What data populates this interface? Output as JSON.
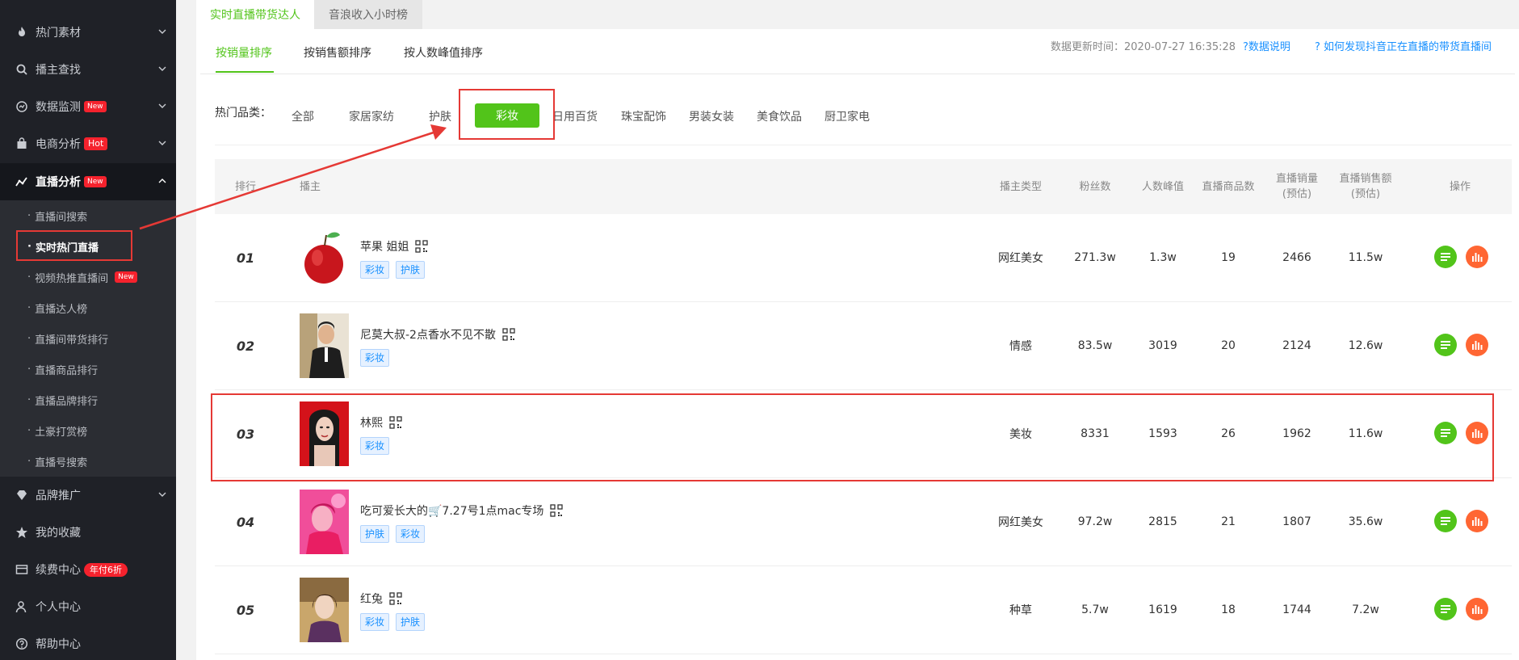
{
  "sidebar": {
    "items": [
      {
        "label": "热门素材",
        "icon": "fire-icon"
      },
      {
        "label": "播主查找",
        "icon": "search-icon"
      },
      {
        "label": "数据监测",
        "icon": "monitor-icon",
        "badge": "New"
      },
      {
        "label": "电商分析",
        "icon": "shopping-bag-icon",
        "badge": "Hot"
      },
      {
        "label": "直播分析",
        "icon": "line-chart-icon",
        "badge": "New"
      },
      {
        "label": "品牌推广",
        "icon": "diamond-icon"
      },
      {
        "label": "我的收藏",
        "icon": "star-icon"
      },
      {
        "label": "续费中心",
        "icon": "card-icon",
        "badge": "年付6折"
      },
      {
        "label": "个人中心",
        "icon": "user-icon"
      },
      {
        "label": "帮助中心",
        "icon": "help-icon"
      }
    ],
    "live_sub_items": [
      {
        "label": "直播间搜索"
      },
      {
        "label": "实时热门直播"
      },
      {
        "label": "视频热推直播间",
        "badge": "New"
      },
      {
        "label": "直播达人榜"
      },
      {
        "label": "直播间带货排行"
      },
      {
        "label": "直播商品排行"
      },
      {
        "label": "直播品牌排行"
      },
      {
        "label": "土豪打赏榜"
      },
      {
        "label": "直播号搜索"
      }
    ]
  },
  "top_tabs": [
    {
      "label": "实时直播带货达人",
      "active": true
    },
    {
      "label": "音浪收入小时榜",
      "active": false
    }
  ],
  "sort_tabs": [
    {
      "label": "按销量排序",
      "active": true
    },
    {
      "label": "按销售额排序",
      "active": false
    },
    {
      "label": "按人数峰值排序",
      "active": false
    }
  ],
  "update_info": "数据更新时间：2020-07-27 16:35:28",
  "links": {
    "data_note": "数据说明",
    "how_to_find": "如何发现抖音正在直播的带货直播间"
  },
  "categories": {
    "label": "热门品类：",
    "items": [
      "全部",
      "家居家纺",
      "护肤",
      "彩妆",
      "日用百货",
      "珠宝配饰",
      "男装女装",
      "美食饮品",
      "厨卫家电"
    ],
    "selected": "彩妆"
  },
  "table": {
    "headers": {
      "rank": "排行",
      "host": "播主",
      "type": "播主类型",
      "fans": "粉丝数",
      "peak": "人数峰值",
      "goods": "直播商品数",
      "sales_l1": "直播销量",
      "sales_l2": "(预估)",
      "amount_l1": "直播销售额",
      "amount_l2": "(预估)",
      "ops": "操作"
    },
    "rows": [
      {
        "rank": "01",
        "name": "苹果 姐姐",
        "tags": [
          "彩妆",
          "护肤"
        ],
        "type": "网红美女",
        "fans": "271.3w",
        "peak": "1.3w",
        "goods": "19",
        "sales": "2466",
        "amount": "11.5w"
      },
      {
        "rank": "02",
        "name": "尼莫大叔-2点香水不见不散",
        "tags": [
          "彩妆"
        ],
        "type": "情感",
        "fans": "83.5w",
        "peak": "3019",
        "goods": "20",
        "sales": "2124",
        "amount": "12.6w"
      },
      {
        "rank": "03",
        "name": "林熙",
        "tags": [
          "彩妆"
        ],
        "type": "美妆",
        "fans": "8331",
        "peak": "1593",
        "goods": "26",
        "sales": "1962",
        "amount": "11.6w"
      },
      {
        "rank": "04",
        "name": "吃可爱长大的🛒7.27号1点mac专场",
        "tags": [
          "护肤",
          "彩妆"
        ],
        "type": "网红美女",
        "fans": "97.2w",
        "peak": "2815",
        "goods": "21",
        "sales": "1807",
        "amount": "35.6w"
      },
      {
        "rank": "05",
        "name": "红兔",
        "tags": [
          "彩妆",
          "护肤"
        ],
        "type": "种草",
        "fans": "5.7w",
        "peak": "1619",
        "goods": "18",
        "sales": "1744",
        "amount": "7.2w"
      }
    ]
  },
  "colors": {
    "accent_green": "#52c41a",
    "annotation_red": "#e53935",
    "sidebar_bg": "#1f2127",
    "link_blue": "#1890ff",
    "stats_orange": "#ff6633"
  }
}
